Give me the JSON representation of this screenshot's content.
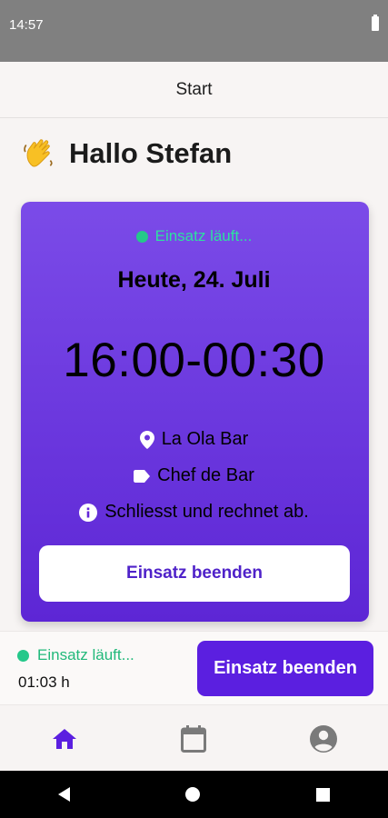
{
  "status_bar": {
    "time": "14:57",
    "battery_icon": "battery-full-icon"
  },
  "header": {
    "title": "Start"
  },
  "greeting": {
    "emoji_icon": "waving-hand-icon",
    "text": "Hallo Stefan"
  },
  "shift_card": {
    "status": "Einsatz läuft...",
    "status_color": "#2ee0a0",
    "date": "Heute, 24. Juli",
    "time_range": "16:00-00:30",
    "location": "La Ola Bar",
    "location_icon": "location-pin-icon",
    "role": "Chef de Bar",
    "role_icon": "tag-icon",
    "note": "Schliesst und rechnet ab.",
    "note_icon": "info-icon",
    "button_label": "Einsatz beenden",
    "accent_color": "#5b1fe0"
  },
  "bottom_panel": {
    "status": "Einsatz läuft...",
    "duration": "01:03 h",
    "button_label": "Einsatz beenden"
  },
  "tabs": [
    {
      "name": "home",
      "icon": "home-icon",
      "active": true
    },
    {
      "name": "calendar",
      "icon": "calendar-icon",
      "active": false
    },
    {
      "name": "profile",
      "icon": "account-circle-icon",
      "active": false
    }
  ],
  "system_nav": {
    "back_icon": "back-icon",
    "home_icon": "home-circle-icon",
    "recent_icon": "recents-icon"
  }
}
